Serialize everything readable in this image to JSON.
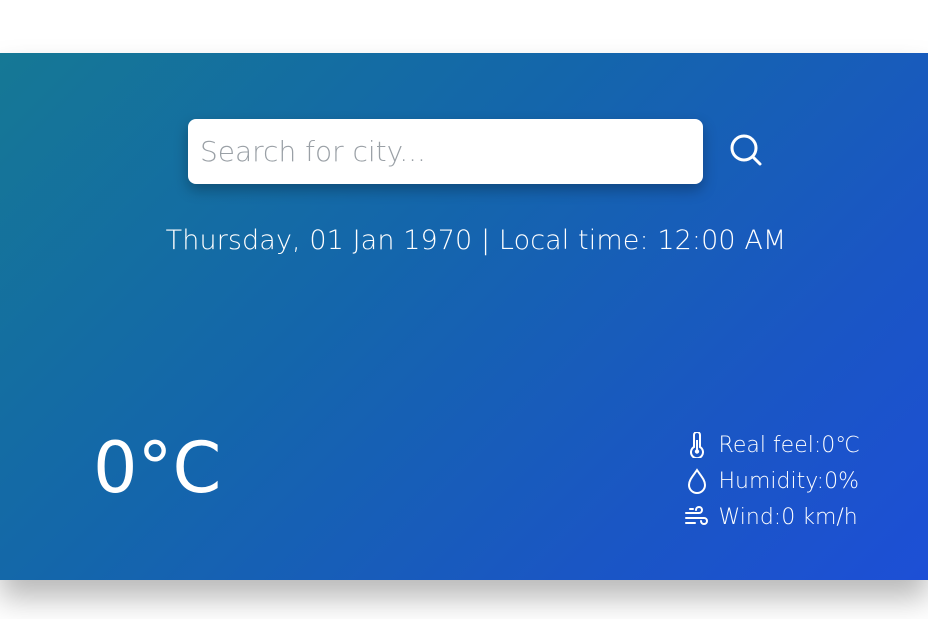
{
  "search": {
    "placeholder": "Search for city...",
    "value": "",
    "button_icon": "search-icon"
  },
  "date_time": "Thursday, 01 Jan 1970 | Local time: 12:00 AM",
  "temperature": "0°C",
  "details": [
    {
      "icon": "thermometer-icon",
      "label": "Real feel:",
      "value": "0℃"
    },
    {
      "icon": "droplet-icon",
      "label": "Humidity:",
      "value": "0%"
    },
    {
      "icon": "wind-icon",
      "label": "Wind:",
      "value": "0 km/h"
    }
  ],
  "colors": {
    "gradient_start": "#157895",
    "gradient_end": "#1d4fd6",
    "text": "#ffffff"
  }
}
